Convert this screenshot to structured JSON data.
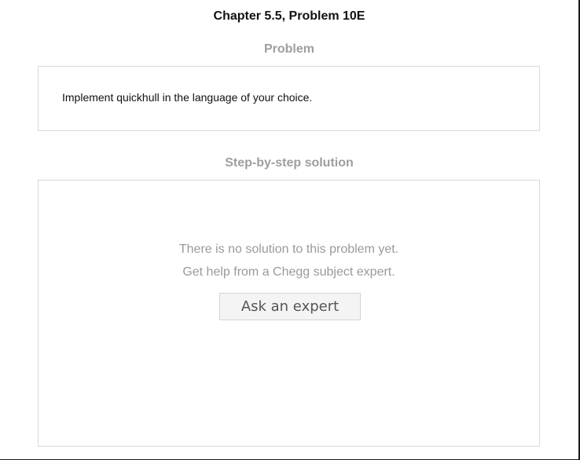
{
  "header": {
    "title": "Chapter 5.5, Problem 10E"
  },
  "problem": {
    "heading": "Problem",
    "text": "Implement quickhull in the language of your choice."
  },
  "solution": {
    "heading": "Step-by-step solution",
    "message_line1": "There is no solution to this problem yet.",
    "message_line2": "Get help from a Chegg subject expert.",
    "ask_button_label": "Ask an expert"
  },
  "colors": {
    "title": "#111111",
    "heading_gray": "#9e9e9e",
    "panel_border": "#d9d9d9",
    "button_bg": "#f4f4f4"
  }
}
